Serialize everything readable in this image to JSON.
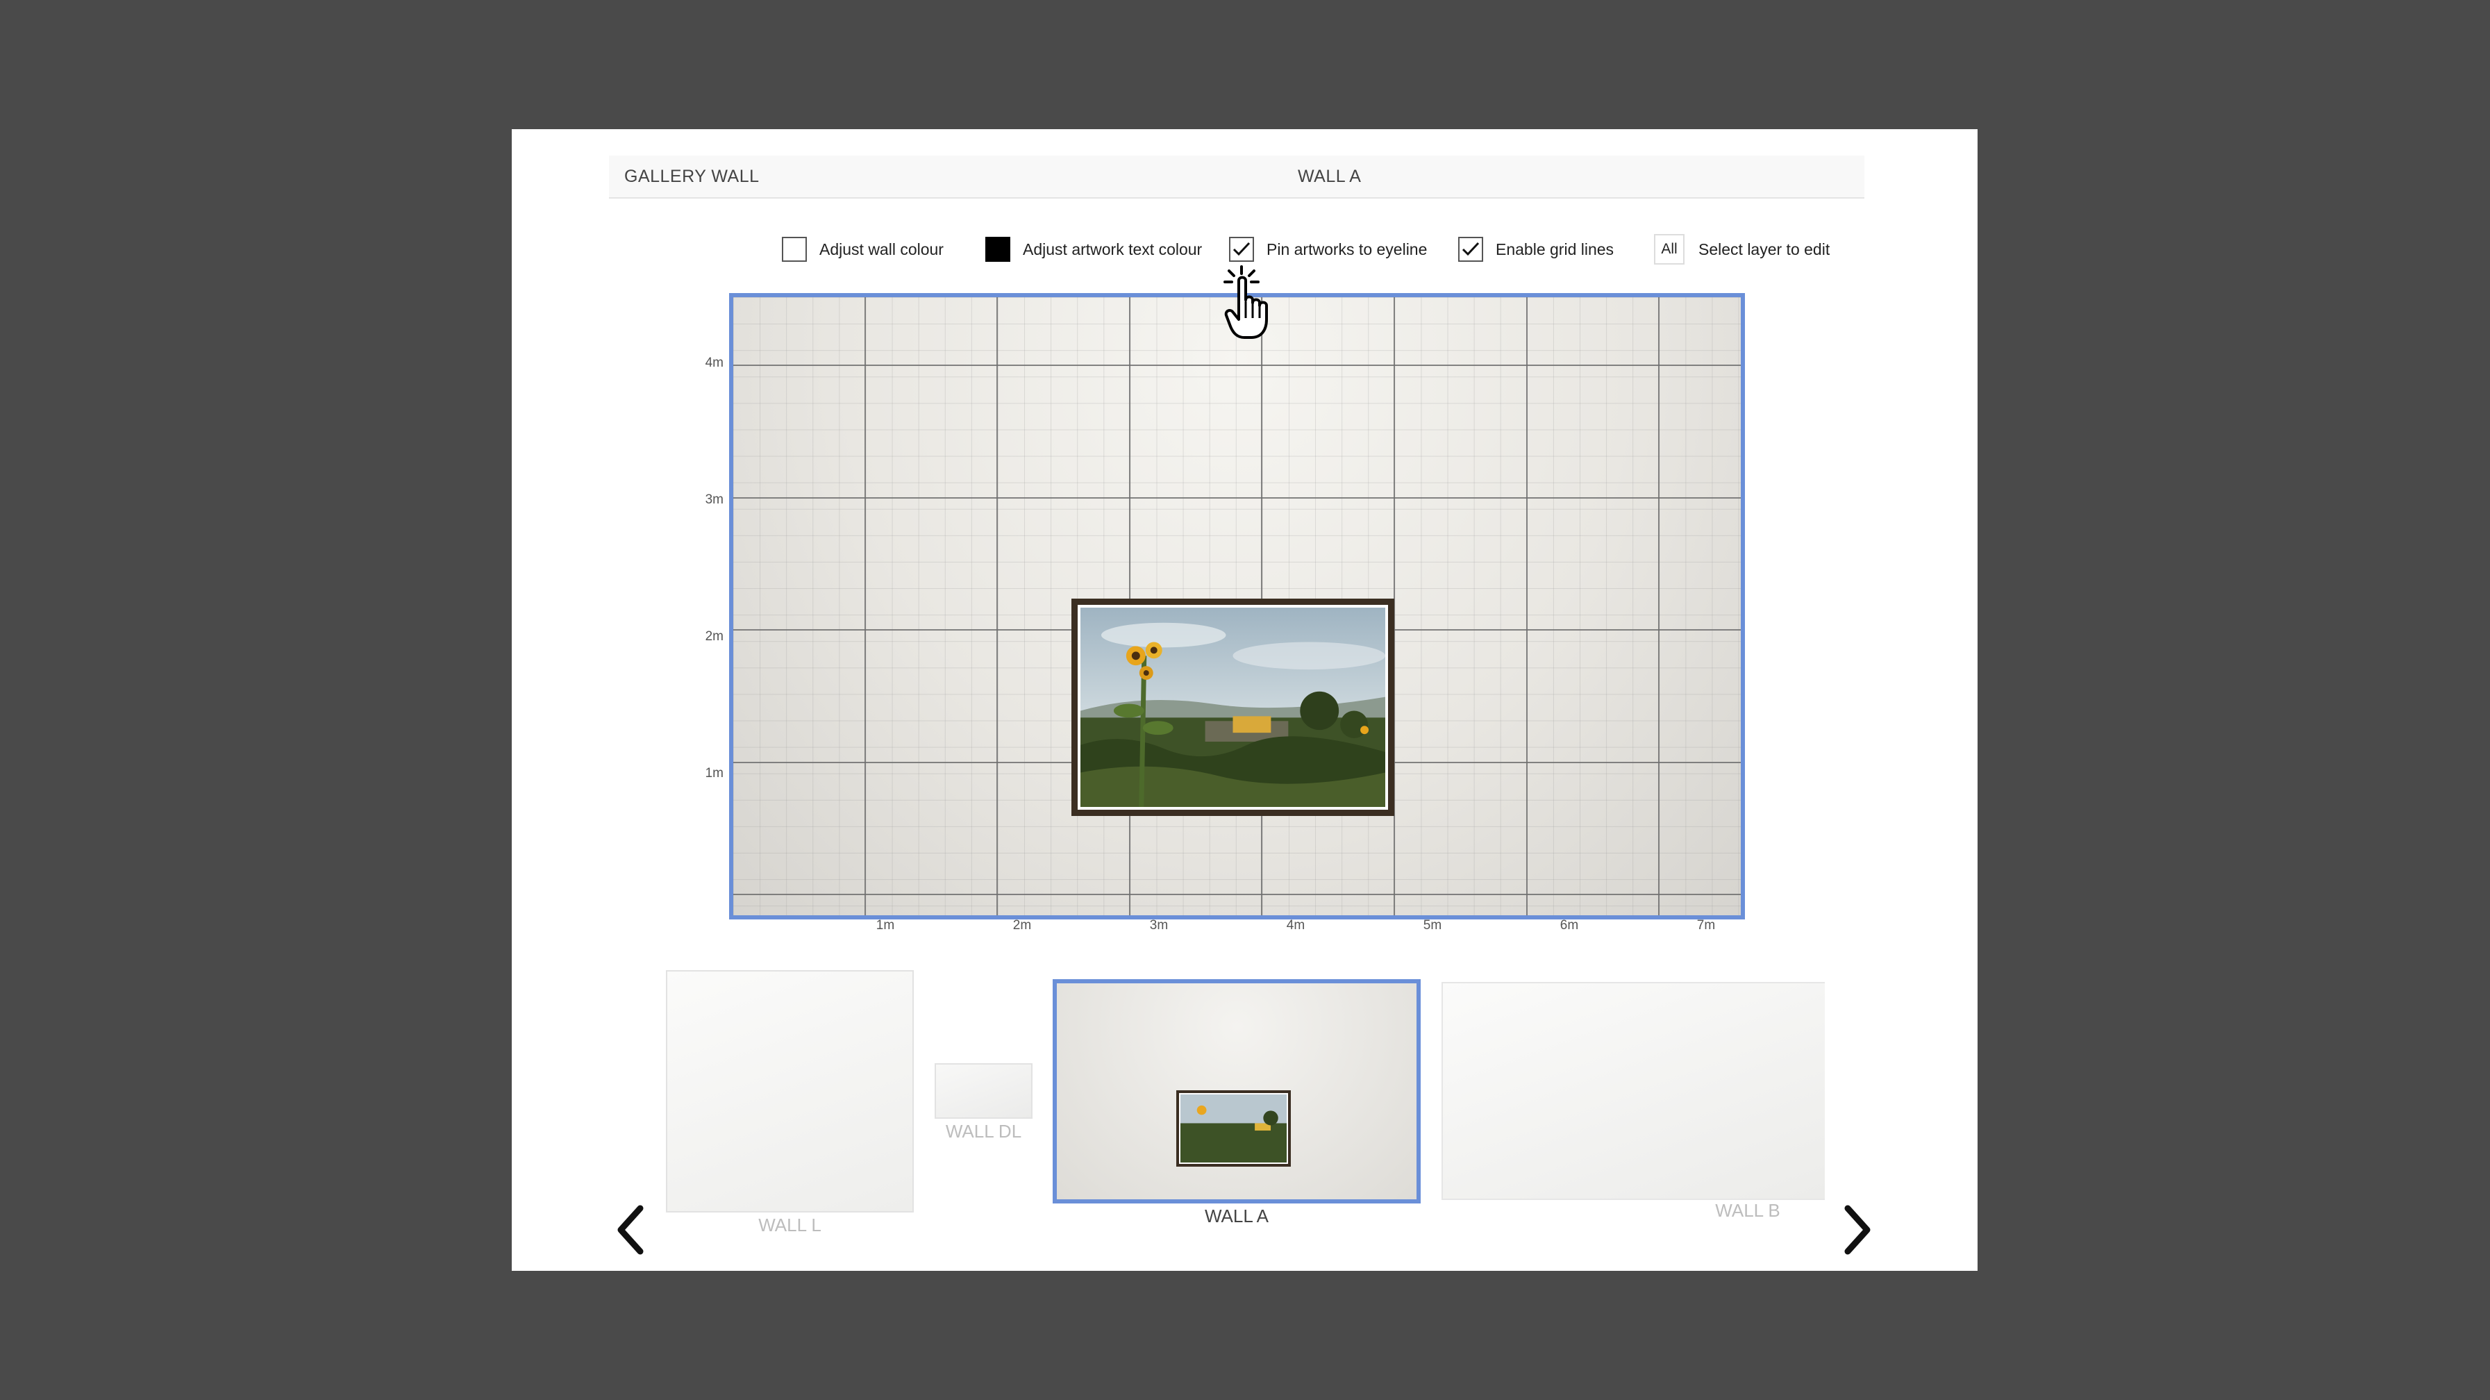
{
  "header": {
    "left_title": "GALLERY WALL",
    "center_title": "WALL A"
  },
  "options": [
    {
      "label": "Adjust wall colour",
      "state": "unchecked"
    },
    {
      "label": "Adjust artwork text colour",
      "state": "color-black"
    },
    {
      "label": "Pin artworks to eyeline",
      "state": "checked"
    },
    {
      "label": "Enable grid lines",
      "state": "checked"
    }
  ],
  "layer_select": {
    "button": "All",
    "label": "Select layer to edit"
  },
  "wall": {
    "y_ticks": [
      "4m",
      "3m",
      "2m",
      "1m"
    ],
    "x_ticks": [
      "1m",
      "2m",
      "3m",
      "4m",
      "5m",
      "6m",
      "7m"
    ]
  },
  "thumbnails": [
    {
      "label": "WALL L",
      "selected": false
    },
    {
      "label": "WALL DL",
      "selected": false
    },
    {
      "label": "WALL A",
      "selected": true
    },
    {
      "label": "WALL B",
      "selected": false
    }
  ],
  "colors": {
    "accent": "#6a8fd8",
    "frame": "#3b2e22",
    "backdrop": "#4a4a4a"
  },
  "icons": [
    "chevron-left-icon",
    "chevron-right-icon",
    "checkmark-icon",
    "pointer-hand-icon"
  ]
}
